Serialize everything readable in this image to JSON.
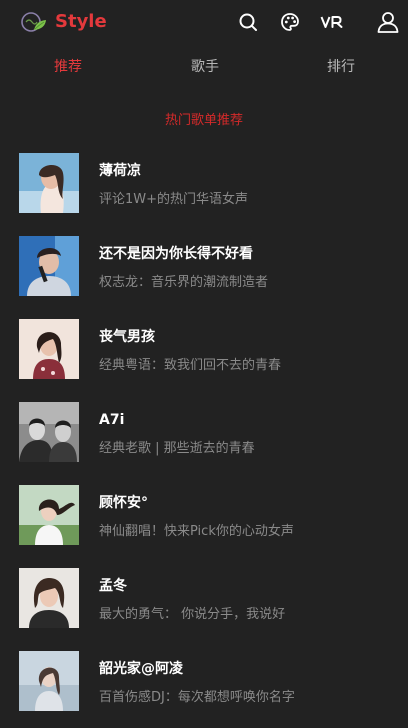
{
  "header": {
    "brand": "Style",
    "icons": [
      "search-icon",
      "palette-icon",
      "vr-icon",
      "user-icon"
    ],
    "vr_label": "VR"
  },
  "tabs": [
    {
      "label": "推荐",
      "active": true
    },
    {
      "label": "歌手",
      "active": false
    },
    {
      "label": "排行",
      "active": false
    }
  ],
  "section_title": "热门歌单推荐",
  "playlists": [
    {
      "title": "薄荷凉",
      "subtitle": "评论1W+的热门华语女声"
    },
    {
      "title": "还不是因为你长得不好看",
      "subtitle": "权志龙：音乐界的潮流制造者"
    },
    {
      "title": "丧气男孩",
      "subtitle": "经典粤语：致我们回不去的青春"
    },
    {
      "title": "A7i",
      "subtitle": "经典老歌 | 那些逝去的青春"
    },
    {
      "title": "顾怀安°",
      "subtitle": "神仙翻唱！快来Pick你的心动女声"
    },
    {
      "title": "孟冬",
      "subtitle": "最大的勇气： 你说分手，我说好"
    },
    {
      "title": "韶光家@阿凌",
      "subtitle": "百首伤感DJ：每次都想呼唤你名字"
    }
  ],
  "colors": {
    "background": "#222222",
    "accent": "#e4393c",
    "title_text": "#ffffff",
    "subtitle_text": "#8a8a8a",
    "tab_text": "#b8b8b8"
  }
}
